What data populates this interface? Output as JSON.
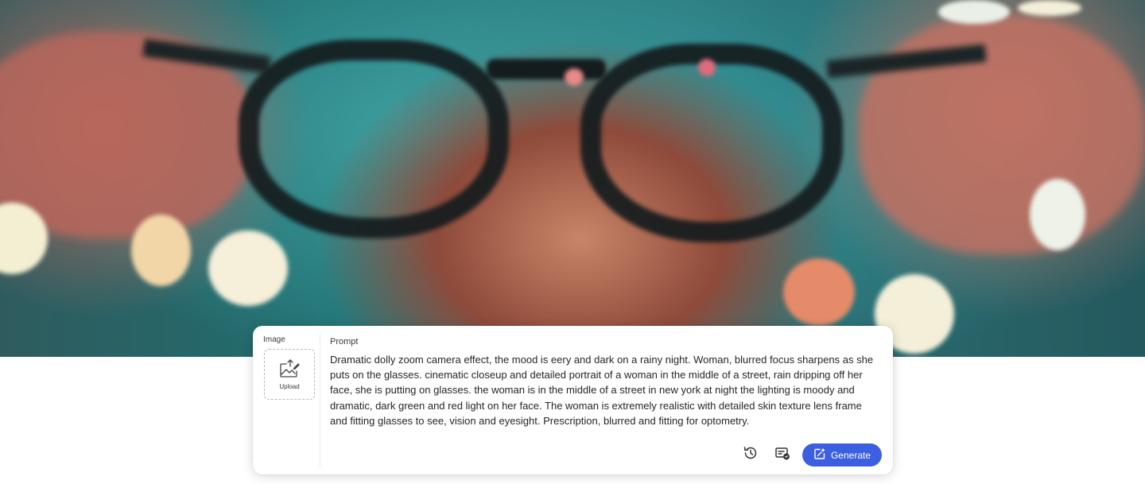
{
  "hero": {
    "description_icon": "hero-video-frame"
  },
  "panel": {
    "image_section": {
      "label": "Image",
      "upload_label": "Upload",
      "upload_icon": "upload-image-icon"
    },
    "prompt_section": {
      "label": "Prompt",
      "value": "Dramatic dolly zoom camera effect, the mood is eery and dark on a rainy night. Woman, blurred focus sharpens as she puts on the glasses. cinematic closeup and detailed portrait of a woman in the middle of a street, rain dripping off her face, she is putting on glasses. the woman is in the middle of a street in new york at night the lighting is moody and dramatic, dark green and red light on her face. The woman is extremely realistic with detailed skin texture lens frame and fitting glasses to see, vision and eyesight. Prescription, blurred and fitting for optometry."
    },
    "actions": {
      "history_icon": "history-icon",
      "settings_icon": "generation-settings-icon",
      "generate_label": "Generate",
      "generate_icon": "generate-icon"
    }
  },
  "colors": {
    "accent": "#3b5fe0",
    "panel_bg": "#ffffff",
    "text": "#262626"
  }
}
